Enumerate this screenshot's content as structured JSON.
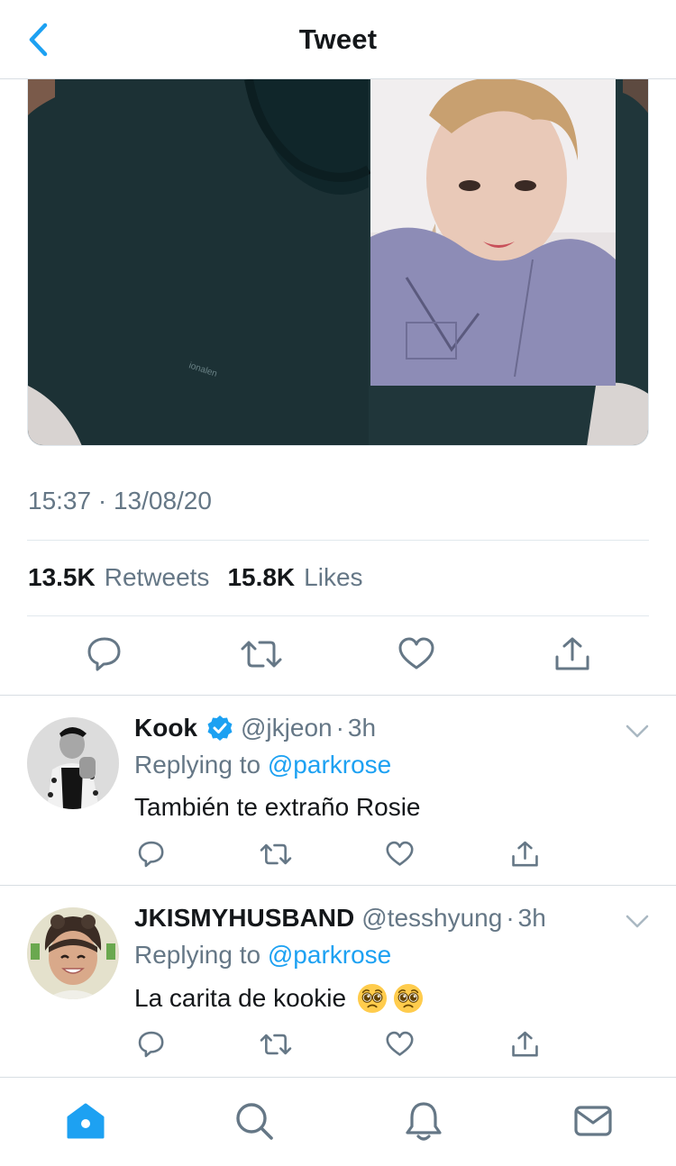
{
  "header": {
    "title": "Tweet",
    "back_icon": "chevron-left-icon"
  },
  "tweet": {
    "media_icon": "photo",
    "timestamp": "15:37 · 13/08/20",
    "retweet_count": "13.5K",
    "retweet_label": "Retweets",
    "like_count": "15.8K",
    "like_label": "Likes",
    "actions": [
      "reply-icon",
      "retweet-icon",
      "like-icon",
      "share-icon"
    ]
  },
  "replies": [
    {
      "display_name": "Kook",
      "verified": true,
      "handle": "@jkjeon",
      "separator": "·",
      "time": "3h",
      "replying_prefix": "Replying to",
      "replying_to": "@parkrose",
      "text": "También te extraño Rosie",
      "emojis": []
    },
    {
      "display_name": "JKISMYHUSBAND",
      "verified": false,
      "handle": "@tesshyung",
      "separator": "·",
      "time": "3h",
      "replying_prefix": "Replying to",
      "replying_to": "@parkrose",
      "text": "La carita de kookie",
      "emojis": [
        "pleading-face",
        "pleading-face"
      ]
    }
  ],
  "tab_bar": {
    "items": [
      "home-icon",
      "search-icon",
      "notifications-icon",
      "messages-icon"
    ],
    "active": "home-icon"
  },
  "colors": {
    "accent": "#1da1f2",
    "text_primary": "#14171a",
    "text_secondary": "#657786",
    "divider": "#e1e8ed"
  }
}
